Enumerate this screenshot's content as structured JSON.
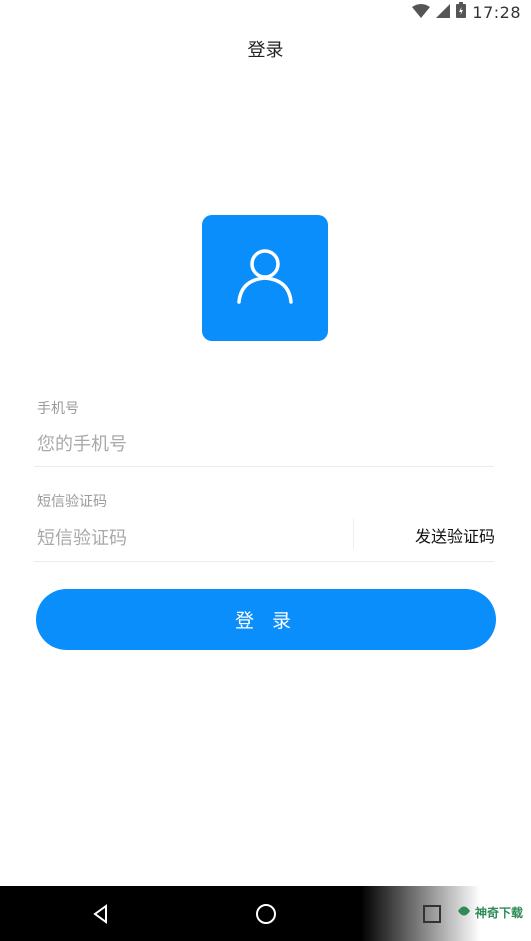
{
  "status_bar": {
    "time": "17:28",
    "icons": [
      "wifi-icon",
      "signal-icon",
      "battery-icon"
    ]
  },
  "header": {
    "title": "登录"
  },
  "avatar": {
    "icon": "user-icon",
    "color": "#0a8efb"
  },
  "form": {
    "phone_label": "手机号",
    "phone_placeholder": "您的手机号",
    "code_label": "短信验证码",
    "code_placeholder": "短信验证码",
    "send_code_label": "发送验证码"
  },
  "login_button": {
    "label": "登 录",
    "color": "#0a8efb"
  },
  "nav_bar": {
    "icons": [
      "back-icon",
      "home-icon",
      "recents-icon"
    ]
  },
  "watermark": {
    "text": "神奇下载"
  }
}
